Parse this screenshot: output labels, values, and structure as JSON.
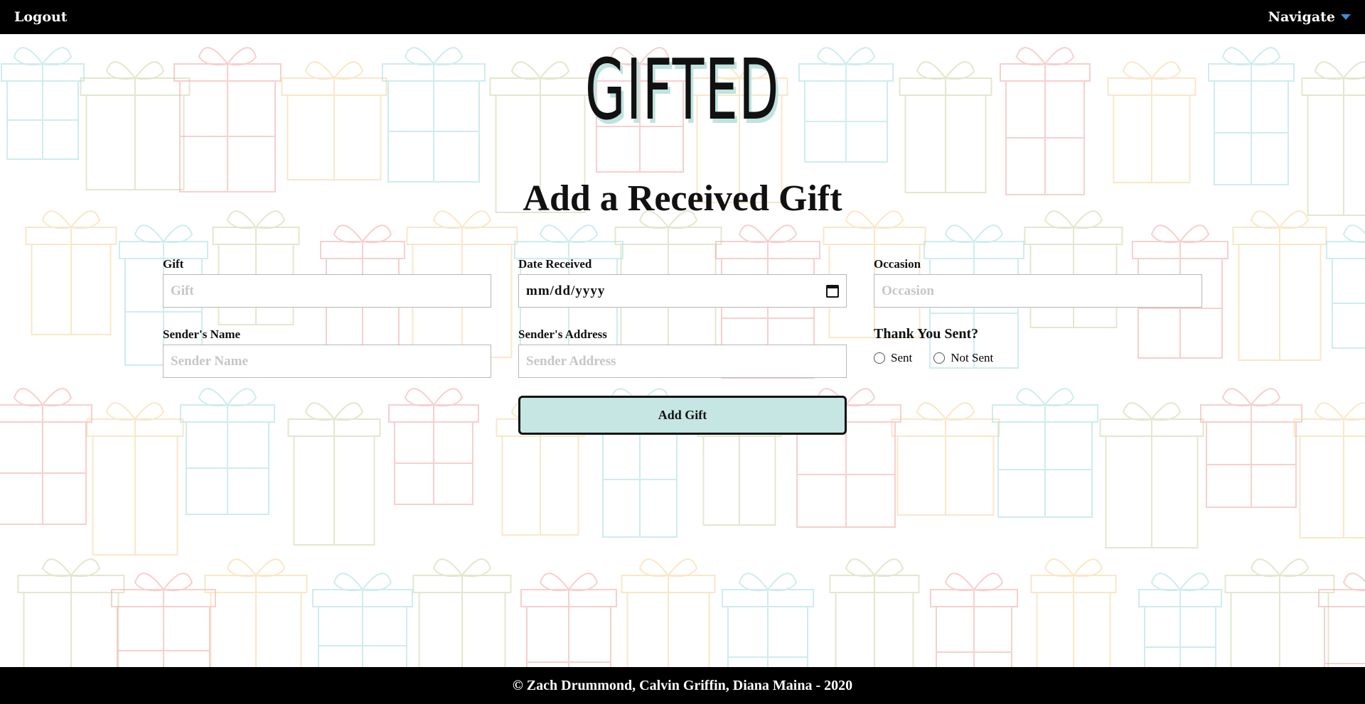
{
  "nav": {
    "logout_label": "Logout",
    "navigate_label": "Navigate"
  },
  "logo": {
    "text": "GIFTED"
  },
  "page_title": "Add a Received Gift",
  "form": {
    "gift": {
      "label": "Gift",
      "placeholder": "Gift"
    },
    "date_received": {
      "label": "Date Received",
      "value": "mm/dd/yyyy"
    },
    "occasion": {
      "label": "Occasion",
      "placeholder": "Occasion"
    },
    "sender_name": {
      "label": "Sender's Name",
      "placeholder": "Sender Name"
    },
    "sender_address": {
      "label": "Sender's Address",
      "placeholder": "Sender Address"
    },
    "thank_you": {
      "label": "Thank You Sent?",
      "options": [
        "Sent",
        "Not Sent"
      ]
    },
    "submit_label": "Add Gift"
  },
  "footer": {
    "text": "© Zach Drummond, Calvin Griffin, Diana Maina - 2020"
  },
  "colors": {
    "accent": "#c5e6e3",
    "caret": "#3a8fd6",
    "bar": "#000000"
  },
  "icons": {
    "caret": "chevron-down-icon",
    "calendar": "calendar-icon"
  }
}
